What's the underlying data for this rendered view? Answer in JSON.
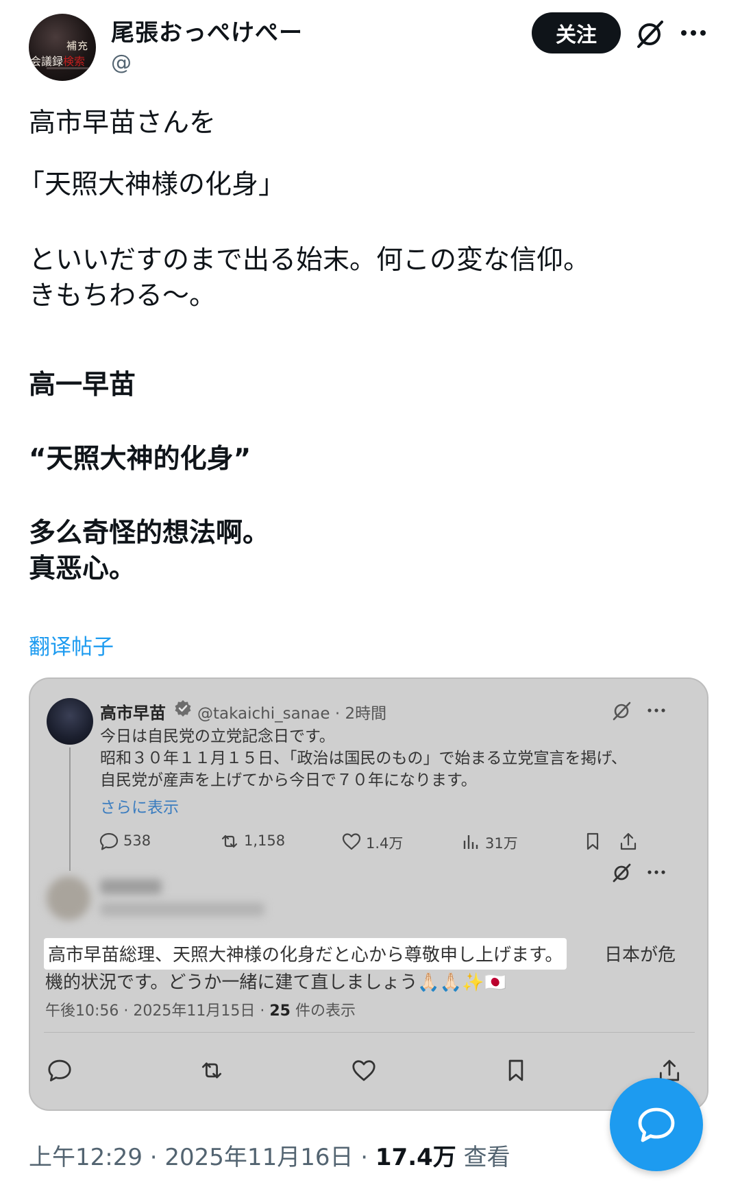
{
  "author": {
    "name": "尾張おっぺけぺー",
    "handle": "@",
    "avatar_text_top": "補充",
    "avatar_text_left": "会議録",
    "avatar_text_red": "検索"
  },
  "header": {
    "follow_label": "关注"
  },
  "post": {
    "lines": [
      "高市早苗さんを",
      "「天照大神様の化身」",
      "といいだすのまで出る始末。何この変な信仰。",
      "きもちわる〜。"
    ]
  },
  "translation": {
    "lines": [
      "高一早苗",
      "“天照大神的化身”",
      "多么奇怪的想法啊。",
      "真恶心。"
    ],
    "link_label": "翻译帖子"
  },
  "embedded": {
    "orig": {
      "name": "高市早苗",
      "handle_time": "@takaichi_sanae · 2時間",
      "lines": [
        "今日は自民党の立党記念日です。",
        "昭和３０年１１月１５日、「政治は国民のもの」で始まる立党宣言を掲げ、",
        "自民党が産声を上げてから今日で７０年になります。"
      ],
      "show_more": "さらに表示",
      "stats": {
        "replies": "538",
        "reposts": "1,158",
        "likes": "1.4万",
        "views": "31万"
      }
    },
    "reply": {
      "highlighted": "高市早苗総理、天照大神様の化身だと心から尊敬申し上げます。",
      "rest_line1": "日本が危",
      "line2": "機的状況です。どうか一緒に建て直しましょう🙏🏻🙏🏻✨🇯🇵",
      "time_prefix": "午後10:56 · 2025年11月15日 · ",
      "view_count": "25",
      "view_suffix": " 件の表示"
    }
  },
  "footer": {
    "time_prefix": "上午12:29 · 2025年11月16日 · ",
    "views": "17.4万",
    "views_suffix": " 查看"
  },
  "colors": {
    "accent": "#1d9bf0",
    "text": "#0f1419",
    "muted": "#536471"
  }
}
